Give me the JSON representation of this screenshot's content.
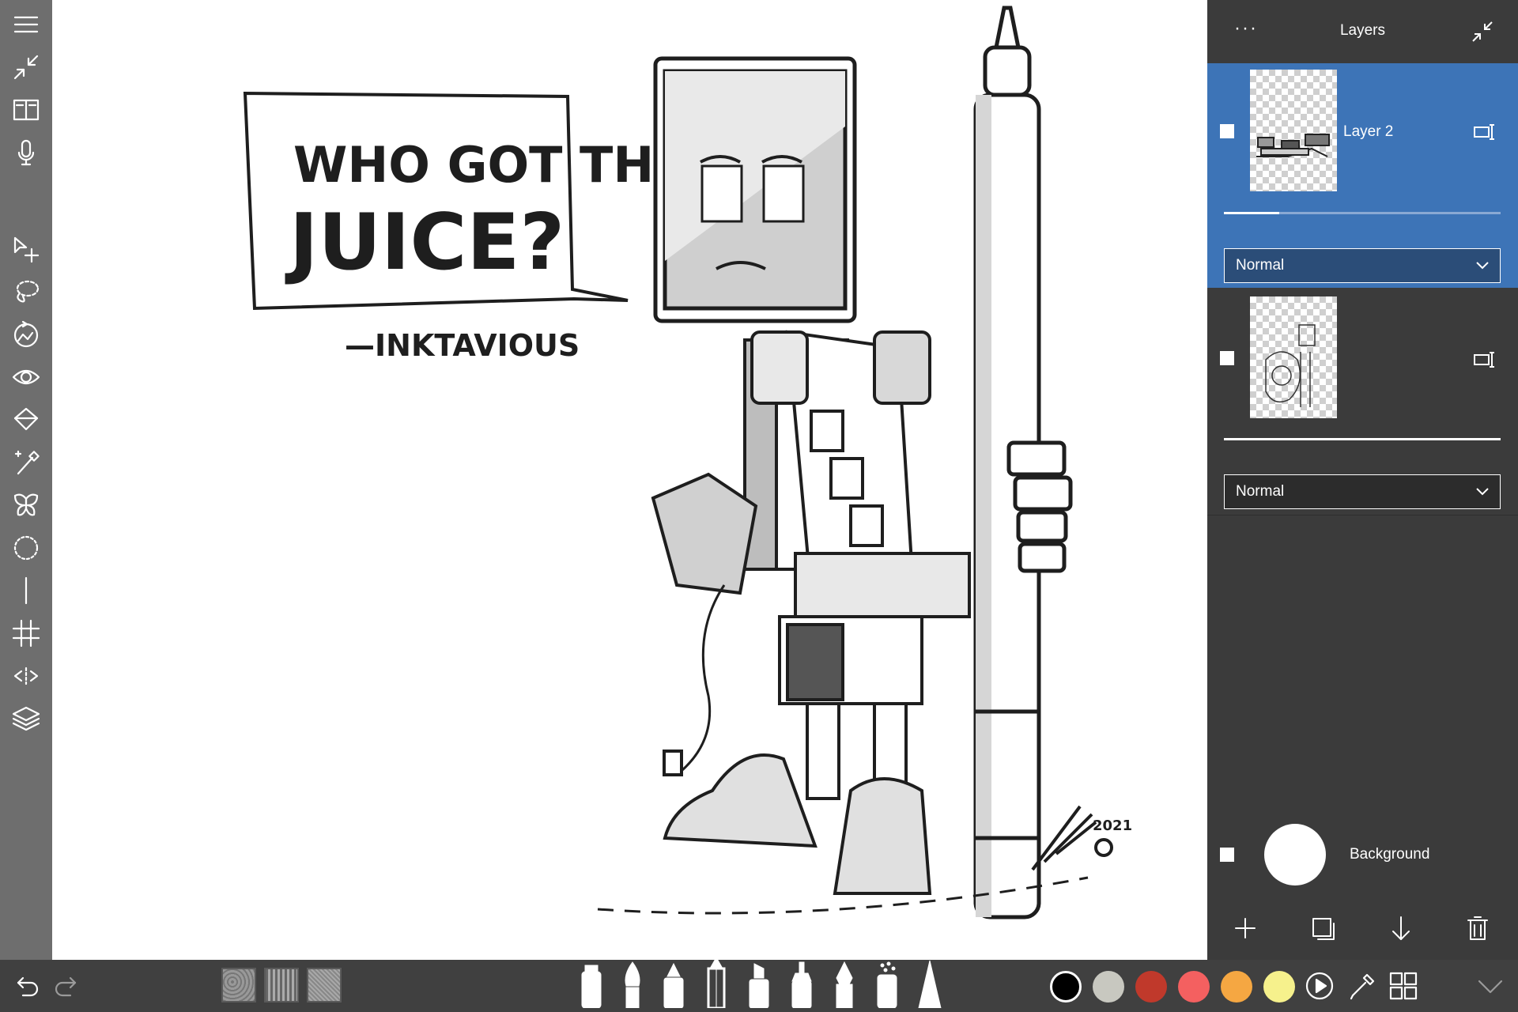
{
  "left_toolbar": {
    "icons": [
      "menu-icon",
      "fit-screen-icon",
      "reference-book-icon",
      "microphone-icon",
      "transform-icon",
      "lasso-select-icon",
      "rotate-canvas-icon",
      "visibility-eye-icon",
      "fill-bucket-icon",
      "magic-wand-icon",
      "symmetry-butterfly-icon",
      "circle-select-icon",
      "line-icon",
      "grid-icon",
      "flip-icon",
      "layers-icon"
    ]
  },
  "canvas": {
    "speech_line_1": "WHO GOT THE",
    "speech_line_2": "JUICE?",
    "signature": "—INKTAVIOUS",
    "artist_mark_year": "2021"
  },
  "layers_panel": {
    "title": "Layers",
    "menu_label": "···",
    "layers": [
      {
        "name": "Layer 2",
        "blend_mode": "Normal",
        "selected": true,
        "opacity": 0.2
      },
      {
        "name": "",
        "blend_mode": "Normal",
        "selected": false,
        "opacity": 1.0
      }
    ],
    "background_label": "Background"
  },
  "bottom_bar": {
    "texture_count": 3,
    "brushes": [
      "marker-icon",
      "round-brush-icon",
      "ink-brush-icon",
      "pencil-icon",
      "chisel-marker-icon",
      "fine-marker-icon",
      "fountain-pen-icon",
      "spray-icon",
      "cone-brush-icon"
    ],
    "colors": [
      "#000000",
      "#c8c8c0",
      "#c0392b",
      "#f46060",
      "#f5a742",
      "#f6f18c"
    ],
    "active_color": "#000000"
  }
}
